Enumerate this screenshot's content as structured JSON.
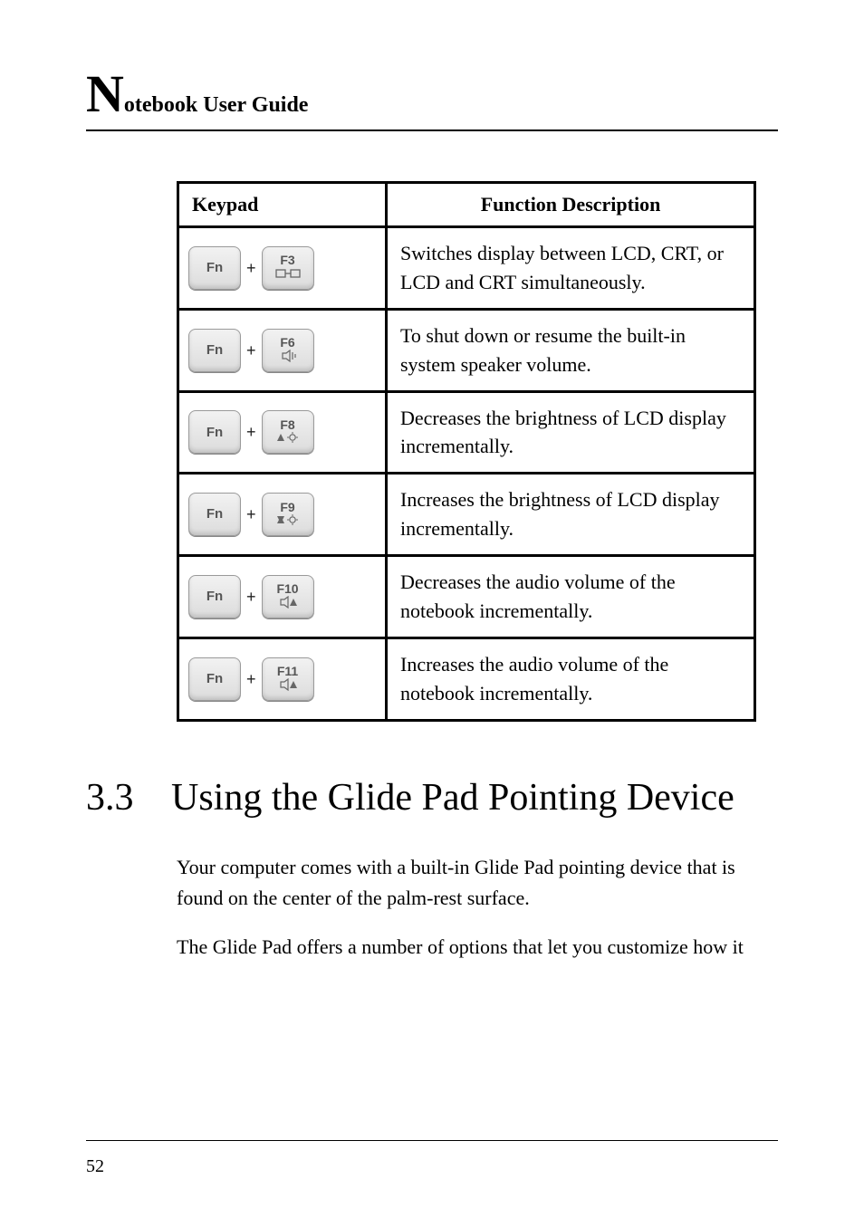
{
  "header": {
    "bigLetter": "N",
    "rest": "otebook User Guide"
  },
  "tableHeaders": {
    "col1": "Keypad",
    "col2": "Function Description"
  },
  "fnKey": "Fn",
  "rows": [
    {
      "fkey": "F3",
      "icon": "display-switch",
      "desc": "Switches display between LCD, CRT, or LCD and CRT simultaneously."
    },
    {
      "fkey": "F6",
      "icon": "speaker-toggle",
      "desc": "To shut down or resume the built-in system speaker volume."
    },
    {
      "fkey": "F8",
      "icon": "brightness-down",
      "desc": "Decreases the brightness of LCD display incrementally."
    },
    {
      "fkey": "F9",
      "icon": "brightness-up",
      "desc": "Increases the brightness of LCD display incrementally."
    },
    {
      "fkey": "F10",
      "icon": "volume-down",
      "desc": "Decreases the audio volume of the notebook incrementally."
    },
    {
      "fkey": "F11",
      "icon": "volume-up",
      "desc": "Increases the audio volume of the notebook incrementally."
    }
  ],
  "section": {
    "num": "3.3",
    "title": "Using the Glide Pad Pointing Device"
  },
  "paragraphs": [
    "Your computer comes with a built-in Glide Pad pointing device that is found on the center of the palm-rest surface.",
    "The Glide Pad offers a number of options that let you customize how it"
  ],
  "pageNumber": "52"
}
